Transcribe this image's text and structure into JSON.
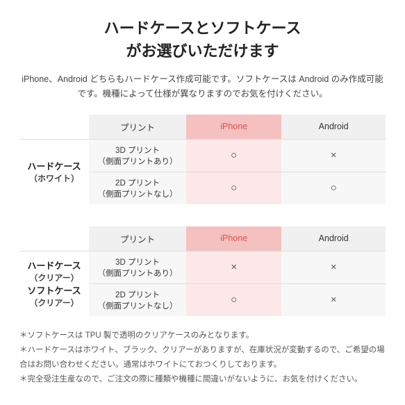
{
  "title": {
    "line1": "ハードケースとソフトケース",
    "line2": "がお選びいただけます"
  },
  "subtitle": "iPhone、Android どちらもハードケース作成可能です。ソフトケースは\nAndroid のみ作成可能です。機種によって仕様が異なりますのでお気を付けください。",
  "table1": {
    "row_header": "ハードケース\n（ホワイト）",
    "row_header_main": "ハードケース",
    "row_header_sub": "（ホワイト）",
    "header": {
      "print": "プリント",
      "iphone": "iPhone",
      "android": "Android"
    },
    "rows": [
      {
        "print": "3D プリント\n（側面プリントあり）",
        "iphone": "○",
        "android": "×"
      },
      {
        "print": "2D プリント\n（側面プリントなし）",
        "iphone": "○",
        "android": "○"
      }
    ]
  },
  "table2": {
    "row_header_main1": "ハードケース",
    "row_header_sub1": "（クリアー）",
    "row_header_main2": "ソフトケース",
    "row_header_sub2": "（クリアー）",
    "header": {
      "print": "プリント",
      "iphone": "iPhone",
      "android": "Android"
    },
    "rows": [
      {
        "print": "3D プリント\n（側面プリントあり）",
        "iphone": "×",
        "android": "×"
      },
      {
        "print": "2D プリント\n（側面プリントなし）",
        "iphone": "○",
        "android": "×"
      }
    ]
  },
  "notes": [
    "ソフトケースは TPU 製で透明のクリアケースのみとなります。",
    "ハードケースはホワイト、ブラック、クリアーがありますが、在庫状況が変動するので、ご希望の場合はお問い合わせください。通常はホワイトにておつくりしております。",
    "完全受注生産なので、ご注文の際に種類や機種に間違いがないように、お気を付けください。"
  ]
}
